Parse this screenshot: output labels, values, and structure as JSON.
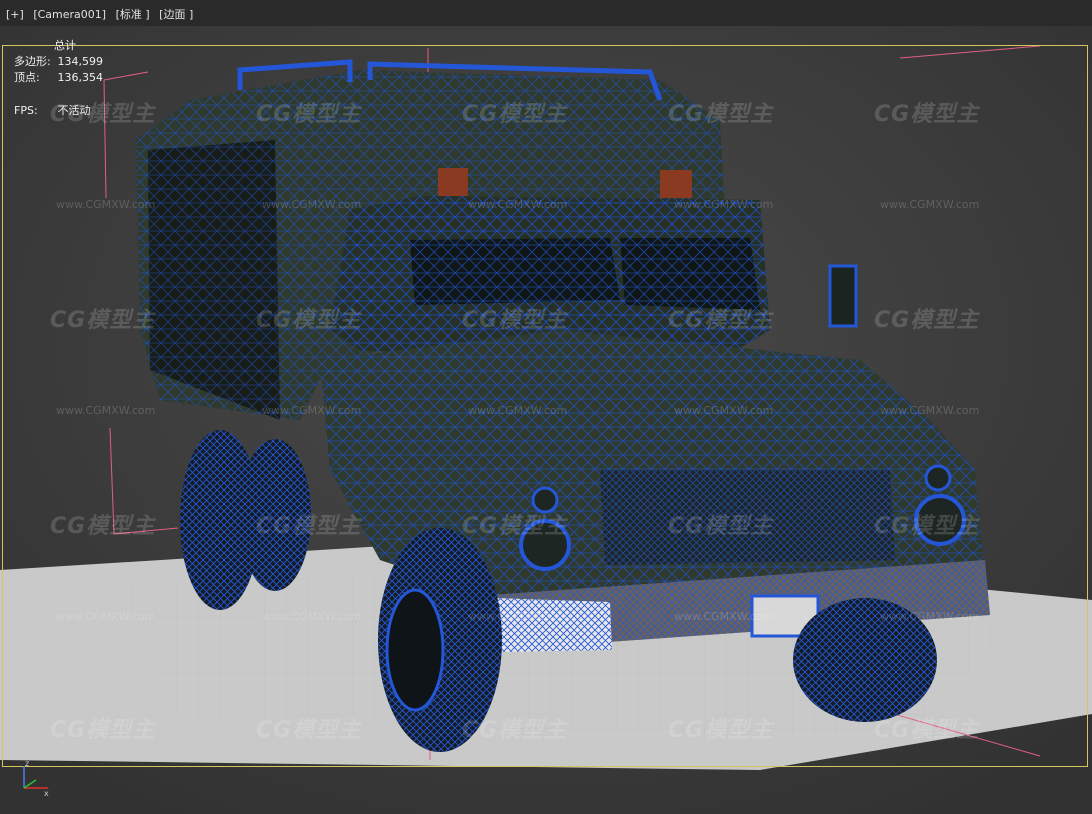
{
  "viewport_menu": {
    "plus": "[+]",
    "camera": "[Camera001]",
    "shading": "[标准 ]",
    "edges": "[边面 ]"
  },
  "stats": {
    "header": "总计",
    "polygons_label": "多边形:",
    "polygons_value": "134,599",
    "vertices_label": "顶点:",
    "vertices_value": "136,354",
    "fps_label": "FPS:",
    "fps_value": "不活动"
  },
  "watermark": {
    "brand": "CG模型主",
    "url": "www.CGMXW.com"
  },
  "gizmo": {
    "z_label": "z",
    "x_label": "x"
  },
  "colors": {
    "frame": "#d4c65a",
    "wire": "#1f4fc8",
    "body": "#2f3a2c",
    "ground": "#c9c9c9"
  }
}
